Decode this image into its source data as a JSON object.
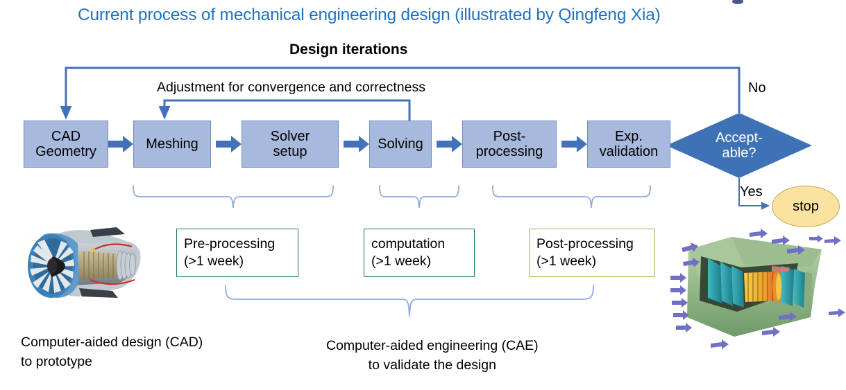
{
  "title": "Current process of mechanical engineering design (illustrated by Qingfeng Xia)",
  "labels": {
    "design_iterations": "Design iterations",
    "adjustment": "Adjustment for convergence and correctness",
    "no": "No",
    "yes": "Yes"
  },
  "process_steps": [
    {
      "id": "cad-geometry",
      "line1": "CAD",
      "line2": "Geometry"
    },
    {
      "id": "meshing",
      "line1": "Meshing",
      "line2": ""
    },
    {
      "id": "solver-setup",
      "line1": "Solver",
      "line2": "setup"
    },
    {
      "id": "solving",
      "line1": "Solving",
      "line2": ""
    },
    {
      "id": "post-processing",
      "line1": "Post-",
      "line2": "processing"
    },
    {
      "id": "exp-validation",
      "line1": "Exp.",
      "line2": "validation"
    }
  ],
  "decision": {
    "line1": "Accept-",
    "line2": "able?"
  },
  "terminator": {
    "label": "stop"
  },
  "phase_boxes": [
    {
      "id": "pre-processing",
      "line1": "Pre-processing",
      "line2": "(>1 week)",
      "border": "#1E7A44"
    },
    {
      "id": "computation",
      "line1": "computation",
      "line2": "(>1 week)",
      "border": "#1E7A44"
    },
    {
      "id": "post-processing",
      "line1": "Post-processing",
      "line2": "(>1 week)",
      "border": "#8CBE4B"
    }
  ],
  "footnotes": [
    {
      "id": "cad-note",
      "line1": "Computer-aided design (CAD)",
      "line2": "to prototype"
    },
    {
      "id": "cae-note",
      "line1": "Computer-aided engineering (CAE)",
      "line2": "to validate the design"
    }
  ],
  "images": [
    {
      "id": "jet-engine-cad-image",
      "alt": "jet engine cutaway CAD rendering"
    },
    {
      "id": "cfd-simulation-image",
      "alt": "CFD simulation of turbofan with velocity vectors"
    }
  ],
  "colors": {
    "title": "#1F72C0",
    "box_fill": "#A7B9DC",
    "box_border": "#6E8CC4",
    "arrow": "#4472B8",
    "diamond": "#3E72B5",
    "brace": "#8FAADC",
    "stop_fill": "#FBE2A1",
    "stop_border": "#C9A24B"
  }
}
